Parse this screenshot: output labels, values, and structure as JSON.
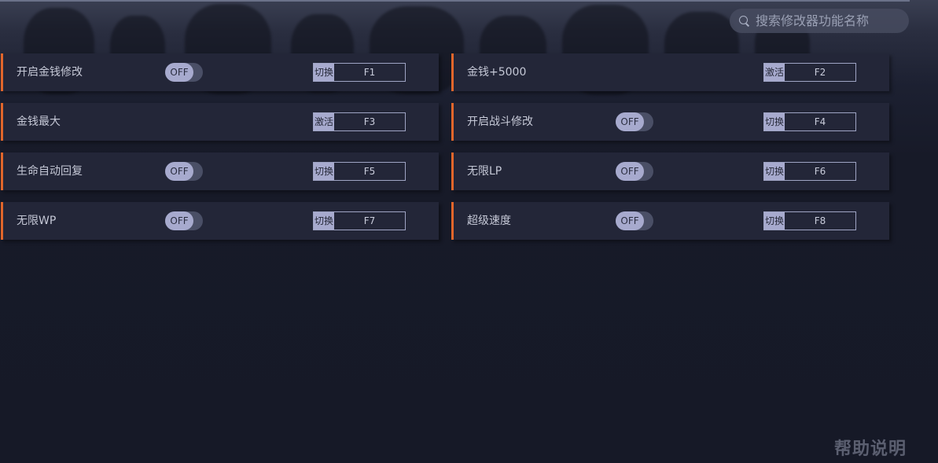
{
  "search": {
    "placeholder": "搜索修改器功能名称"
  },
  "toggle_off_label": "OFF",
  "features": [
    {
      "label": "开启金钱修改",
      "has_toggle": true,
      "mode": "切换",
      "key": "F1"
    },
    {
      "label": "金钱+5000",
      "has_toggle": false,
      "mode": "激活",
      "key": "F2"
    },
    {
      "label": "金钱最大",
      "has_toggle": false,
      "mode": "激活",
      "key": "F3"
    },
    {
      "label": "开启战斗修改",
      "has_toggle": true,
      "mode": "切换",
      "key": "F4"
    },
    {
      "label": "生命自动回复",
      "has_toggle": true,
      "mode": "切换",
      "key": "F5"
    },
    {
      "label": "无限LP",
      "has_toggle": true,
      "mode": "切换",
      "key": "F6"
    },
    {
      "label": "无限WP",
      "has_toggle": true,
      "mode": "切换",
      "key": "F7"
    },
    {
      "label": "超级速度",
      "has_toggle": true,
      "mode": "切换",
      "key": "F8"
    }
  ],
  "help_label": "帮助说明",
  "colors": {
    "accent": "#e2662b",
    "row_bg": "#232638",
    "toggle_knob": "#a7aace"
  }
}
